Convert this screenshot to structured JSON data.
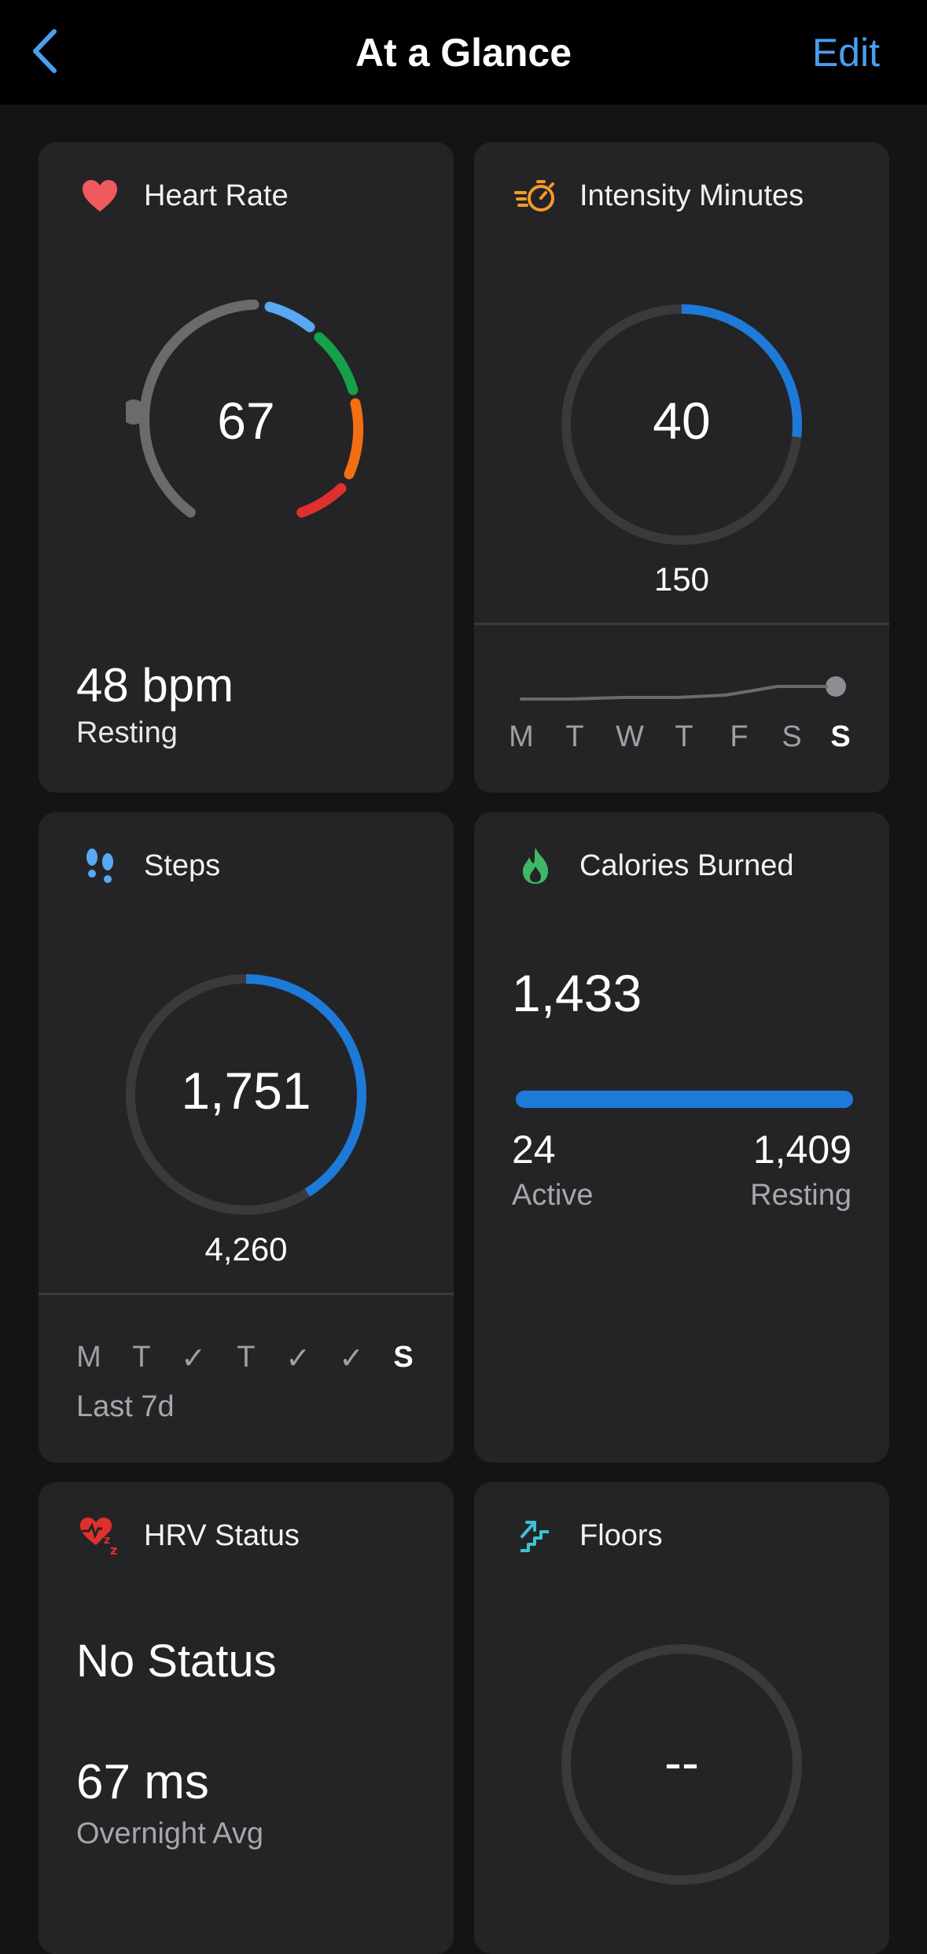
{
  "header": {
    "title": "At a Glance",
    "edit_label": "Edit",
    "accent": "#4a9ff0"
  },
  "heart_rate": {
    "title": "Heart Rate",
    "icon": "heart-icon",
    "current": "67",
    "resting_value": "48 bpm",
    "resting_label": "Resting"
  },
  "intensity": {
    "title": "Intensity Minutes",
    "icon": "stopwatch-icon",
    "value": "40",
    "goal": "150",
    "progress_fraction": 0.267,
    "days": [
      "M",
      "T",
      "W",
      "T",
      "F",
      "S",
      "S"
    ]
  },
  "steps": {
    "title": "Steps",
    "icon": "footprints-icon",
    "value": "1,751",
    "goal": "4,260",
    "progress_fraction": 0.411,
    "days": [
      "M",
      "T",
      "✓",
      "T",
      "✓",
      "✓",
      "S"
    ],
    "period_label": "Last 7d"
  },
  "calories": {
    "title": "Calories Burned",
    "icon": "flame-icon",
    "total": "1,433",
    "active_value": "24",
    "active_label": "Active",
    "resting_value": "1,409",
    "resting_label": "Resting"
  },
  "hrv": {
    "title": "HRV Status",
    "icon": "heart-sleep-icon",
    "status": "No Status",
    "value": "67 ms",
    "value_label": "Overnight Avg"
  },
  "floors": {
    "title": "Floors",
    "icon": "stairs-icon",
    "value": "--"
  }
}
